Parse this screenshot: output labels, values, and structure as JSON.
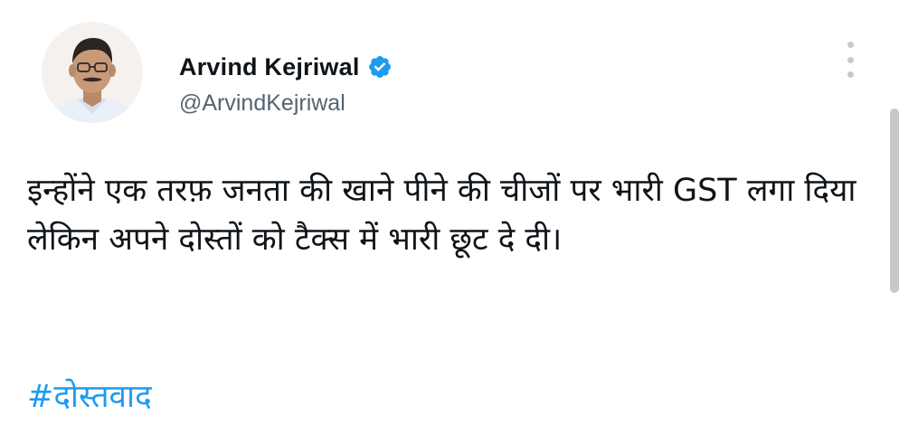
{
  "author": {
    "name": "Arvind Kejriwal",
    "handle": "@ArvindKejriwal",
    "verified": true,
    "avatar_icon": "profile-photo"
  },
  "tweet": {
    "text": "इन्होंने एक तरफ़ जनता की खाने पीने की चीजों पर भारी GST लगा दिया लेकिन अपने दोस्तों को टैक्स में भारी छूट दे दी।",
    "hashtag": "#दोस्तवाद"
  },
  "icons": {
    "verified": "verified-badge-icon",
    "more": "more-options-icon"
  },
  "colors": {
    "text": "#0f1419",
    "handle": "#536471",
    "link": "#1d9bf0",
    "verified": "#1d9bf0"
  }
}
